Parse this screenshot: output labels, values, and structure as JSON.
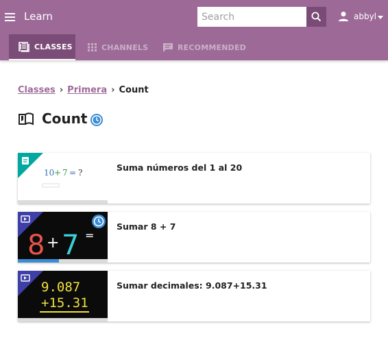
{
  "app": {
    "title": "Learn"
  },
  "search": {
    "placeholder": "Search",
    "value": ""
  },
  "user": {
    "name": "abbyl"
  },
  "tabs": [
    {
      "label": "CLASSES",
      "active": true,
      "icon": "classes-icon"
    },
    {
      "label": "CHANNELS",
      "active": false,
      "icon": "grid-icon"
    },
    {
      "label": "RECOMMENDED",
      "active": false,
      "icon": "chat-icon"
    }
  ],
  "breadcrumb": [
    {
      "label": "Classes",
      "link": true
    },
    {
      "label": "Primera",
      "link": true
    },
    {
      "label": "Count",
      "link": false
    }
  ],
  "breadcrumb_separator": "›",
  "page": {
    "title": "Count",
    "icon": "book-icon",
    "status_icon": "clock-icon"
  },
  "cards": [
    {
      "title": "Suma números del 1 al 20",
      "kind": "exercise",
      "kind_icon": "exercise-icon",
      "badge_color": "#00a8a0",
      "thumb": {
        "text_a": "10",
        "text_op": "+",
        "text_b": "7",
        "text_eq": "=",
        "text_q": "?"
      },
      "progress": 1.0,
      "progress_color": "#dcdcdc",
      "in_progress": false
    },
    {
      "title": "Sumar 8 + 7",
      "kind": "video",
      "kind_icon": "video-icon",
      "badge_color": "#3f3fa8",
      "thumb": {
        "a": "8",
        "op": "+",
        "b": "7",
        "eq": "="
      },
      "progress": 0.46,
      "progress_color": "#3b8cd4",
      "in_progress": true
    },
    {
      "title": "Sumar decimales: 9.087+15.31",
      "kind": "video",
      "kind_icon": "video-icon",
      "badge_color": "#3f3fa8",
      "thumb": {
        "line1": "9.087",
        "line2": "+15.31"
      },
      "progress": 1.0,
      "progress_color": "#dcdcdc",
      "in_progress": false
    }
  ],
  "colors": {
    "brand": "#9d6a98",
    "brand_dark": "#7b4c77",
    "accent": "#3b8cd4"
  }
}
